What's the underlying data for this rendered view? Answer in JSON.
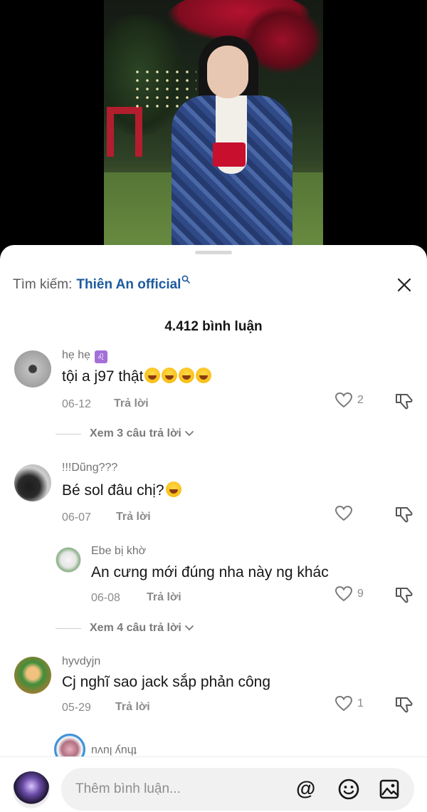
{
  "search": {
    "label": "Tìm kiếm:",
    "term": "Thiên An official"
  },
  "comments_count": "4.412 bình luận",
  "comments": [
    {
      "username": "hẹ hẹ",
      "badge": "♌",
      "text": "tội a j97 thật",
      "date": "06-12",
      "reply_label": "Trả lời",
      "likes": "2"
    },
    {
      "username": "!!!Dũng???",
      "text": "Bé sol đâu chị?",
      "date": "06-07",
      "reply_label": "Trả lời",
      "likes": ""
    },
    {
      "username": "hyvdyjn",
      "text": "Cj nghĩ sao jack sắp phản công",
      "date": "05-29",
      "reply_label": "Trả lời",
      "likes": "1"
    }
  ],
  "replies": [
    {
      "username": "Ebe bị khờ",
      "text": "An cưng mới đúng nha này ng khác",
      "date": "06-08",
      "reply_label": "Trả lời",
      "likes": "9"
    }
  ],
  "view_replies": [
    "Xem 3 câu trả lời",
    "Xem 4 câu trả lời"
  ],
  "cutoff_reply": {
    "username": "thuy luvu"
  },
  "input": {
    "placeholder": "Thêm bình luận...",
    "mention": "@"
  },
  "colors": {
    "search_term": "#1d5a9e",
    "text": "#161616",
    "muted": "#8a8a8a"
  },
  "icons": [
    "search-icon",
    "close-icon",
    "heart-icon",
    "dislike-icon",
    "chevron-down-icon",
    "emoji-icon",
    "image-icon"
  ]
}
